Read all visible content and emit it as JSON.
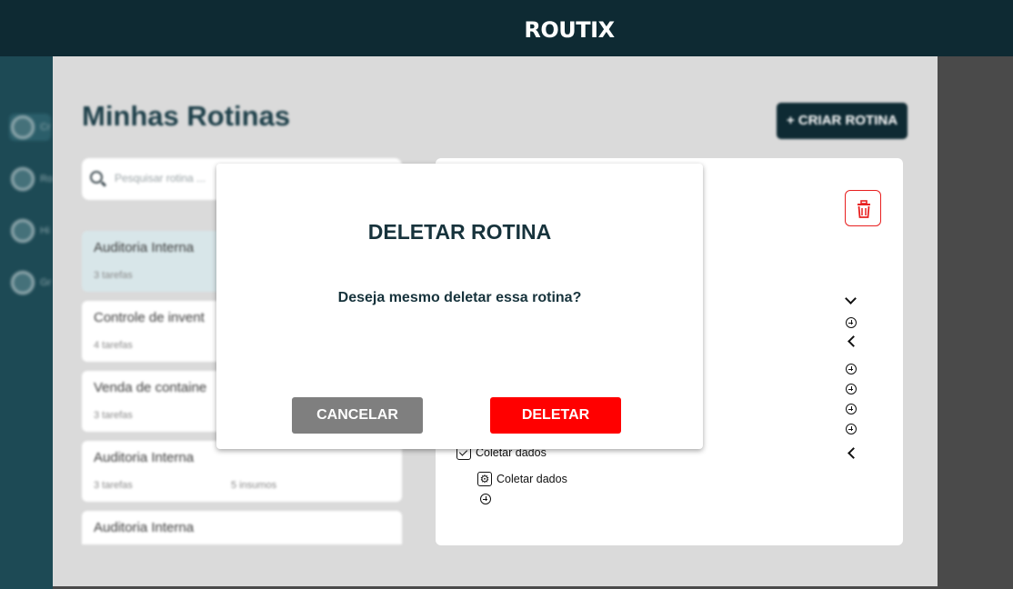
{
  "app": {
    "brand": "ROUTIX"
  },
  "sidebar": {
    "items": [
      {
        "label": "Cr",
        "icon": "circle-plus-icon"
      },
      {
        "label": "Ro",
        "icon": "calendar-icon"
      },
      {
        "label": "Hi",
        "icon": "clock-icon"
      },
      {
        "label": "Gr",
        "icon": "group-icon"
      }
    ]
  },
  "main": {
    "title": "Minhas Rotinas",
    "create_label": "+ CRIAR ROTINA",
    "search_placeholder": "Pesquisar rotina ...",
    "routines": [
      {
        "name": "Auditoria Interna",
        "meta": "3 tarefas",
        "meta2": ""
      },
      {
        "name": "Controle de invent",
        "meta": "4 tarefas",
        "meta2": ""
      },
      {
        "name": "Venda de containe",
        "meta": "3 tarefas",
        "meta2": ""
      },
      {
        "name": "Auditoria Interna",
        "meta": "3 tarefas",
        "meta2": "5 insumos"
      },
      {
        "name": "Auditoria Interna",
        "meta": "",
        "meta2": ""
      }
    ]
  },
  "detail": {
    "steps": [
      {
        "label": "Coletar dados",
        "icon": "checkbox-icon"
      },
      {
        "label": "Coletar dados",
        "icon": "gear-icon"
      }
    ]
  },
  "modal": {
    "title": "DELETAR ROTINA",
    "message": "Deseja mesmo deletar essa rotina?",
    "cancel_label": "CANCELAR",
    "delete_label": "DELETAR"
  },
  "colors": {
    "header": "#0e2a33",
    "sidebar": "#1d4a55",
    "delete_accent": "#ff0000",
    "cancel": "#7f7f7f",
    "title_text": "#17333c"
  }
}
